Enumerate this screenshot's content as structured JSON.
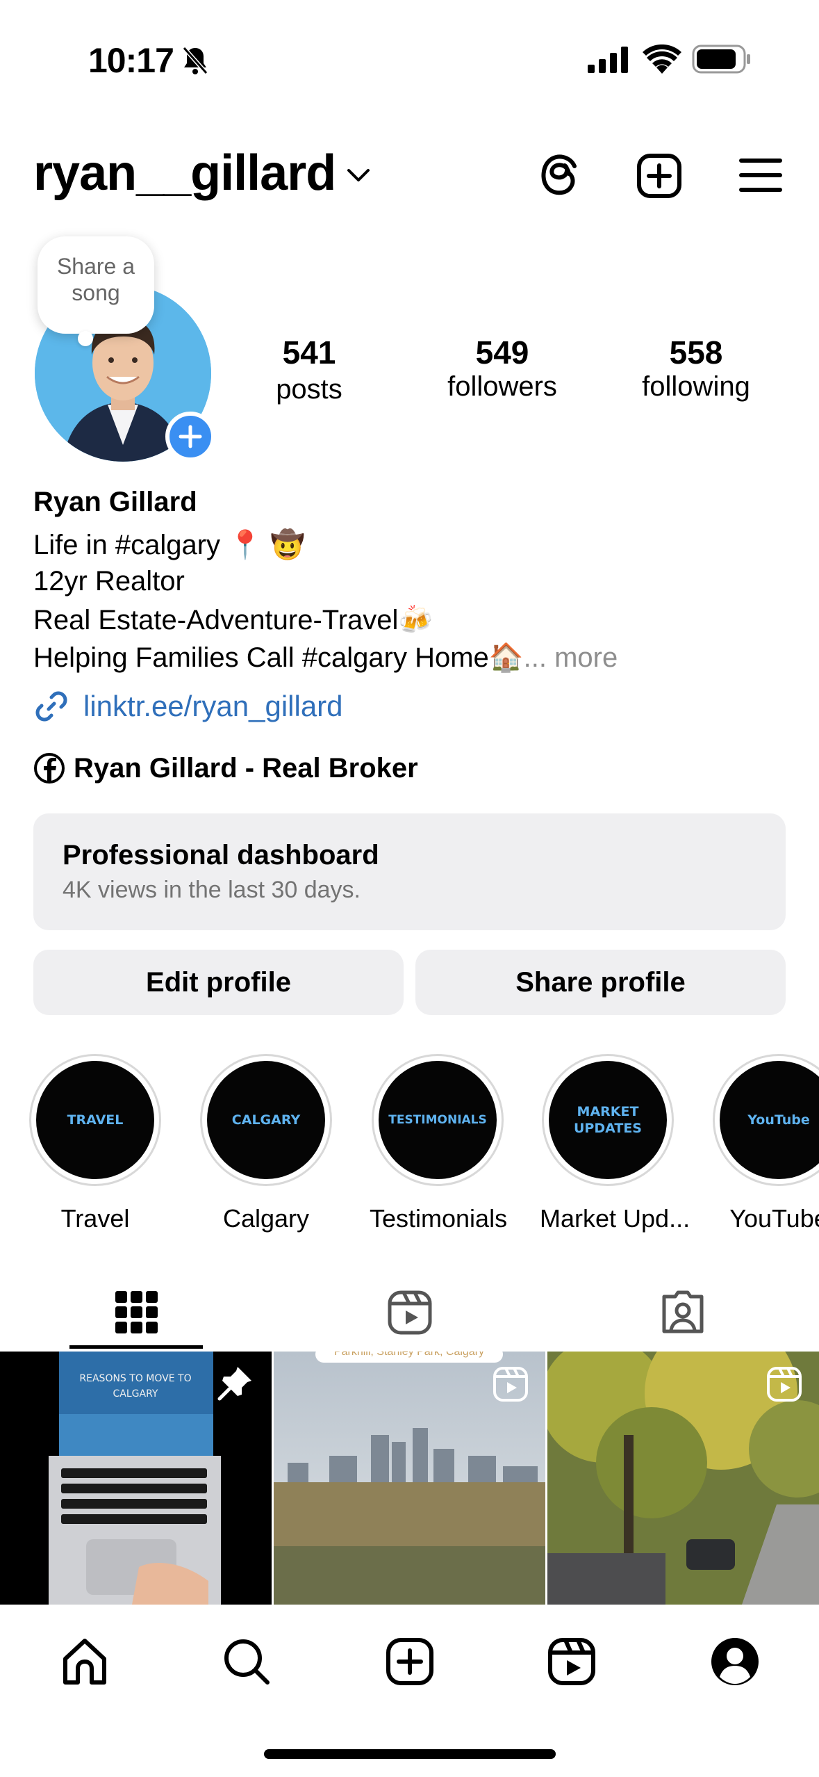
{
  "status_bar": {
    "time": "10:17"
  },
  "header": {
    "username": "ryan__gillard"
  },
  "profile": {
    "note": "Share a song",
    "stats": [
      {
        "value": "541",
        "label": "posts"
      },
      {
        "value": "549",
        "label": "followers"
      },
      {
        "value": "558",
        "label": "following"
      }
    ],
    "name": "Ryan Gillard",
    "bio_lines": [
      "Life in #calgary 📍 🤠",
      "12yr Realtor",
      "Real Estate-Adventure-Travel🍻",
      "Helping Families Call #calgary Home🏠"
    ],
    "more_label": "... more",
    "link": "linktr.ee/ryan_gillard",
    "facebook_page": "Ryan Gillard - Real Broker"
  },
  "dashboard": {
    "title": "Professional dashboard",
    "subtitle": "4K views in the last 30 days."
  },
  "buttons": {
    "edit_profile": "Edit profile",
    "share_profile": "Share profile"
  },
  "highlights": [
    {
      "cover_text": "TRAVEL",
      "label": "Travel"
    },
    {
      "cover_text": "CALGARY",
      "label": "Calgary"
    },
    {
      "cover_text": "TESTIMONIALS",
      "label": "Testimonials"
    },
    {
      "cover_text": "MARKET UPDATES",
      "label": "Market Upd..."
    },
    {
      "cover_text": "YouTube",
      "label": "YouTube"
    }
  ],
  "posts": [
    {
      "overlay_text": "REASONS TO MOVE TO CALGARY",
      "badge": "pin-icon"
    },
    {
      "overlay_text": "Parkhill, Stanley Park, Calgary",
      "badge": "reel-icon"
    },
    {
      "overlay_text": "",
      "badge": "reel-icon"
    }
  ],
  "colors": {
    "link": "#2f6fba",
    "accent_blue": "#3a8ff2",
    "highlight_text": "#5fb3f0",
    "button_bg": "#efeff1"
  }
}
